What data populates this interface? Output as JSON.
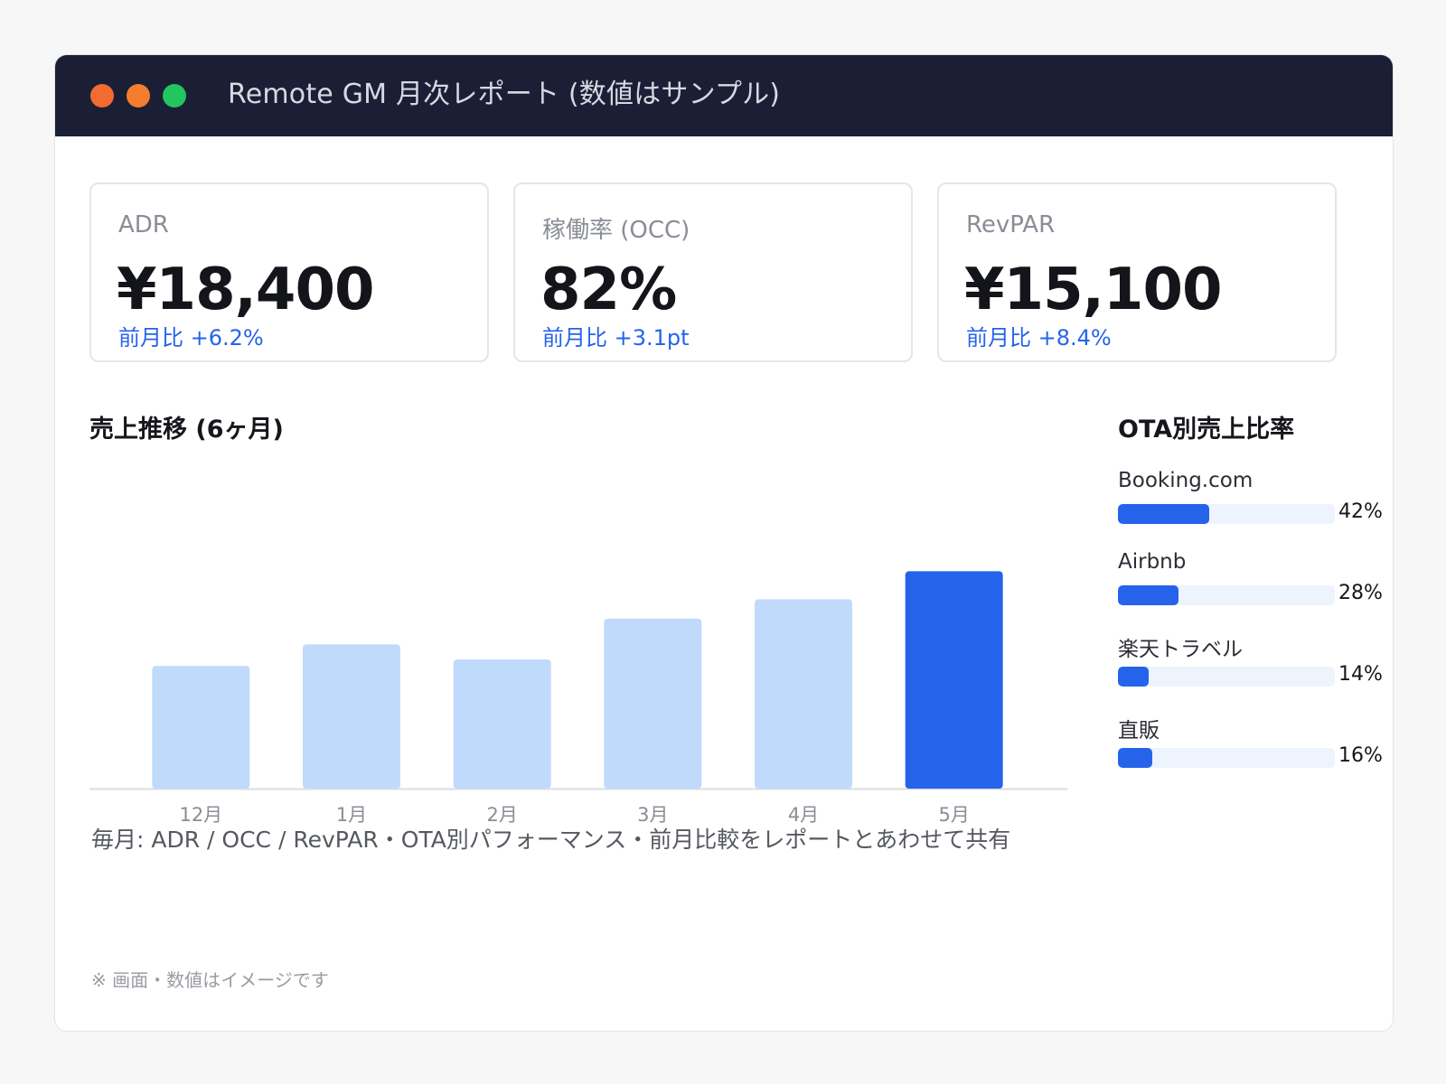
{
  "window": {
    "title": "Remote GM 月次レポート (数値はサンプル)",
    "dot_colors": [
      "#f26b2f",
      "#f47e2e",
      "#22c55e"
    ]
  },
  "kpis": [
    {
      "label": "ADR",
      "value": "¥18,400",
      "delta": "前月比 +6.2%"
    },
    {
      "label": "稼働率 (OCC)",
      "value": "82%",
      "delta": "前月比 +3.1pt"
    },
    {
      "label": "RevPAR",
      "value": "¥15,100",
      "delta": "前月比 +8.4%"
    }
  ],
  "sales": {
    "title": "売上推移 (6ヶ月)"
  },
  "chart_data": {
    "type": "bar",
    "categories": [
      "12月",
      "1月",
      "2月",
      "3月",
      "4月",
      "5月"
    ],
    "values": [
      57,
      67,
      60,
      79,
      88,
      101
    ],
    "ylim": [
      0,
      110
    ],
    "highlight_index": 5,
    "colors": {
      "normal": "#c0dafc",
      "highlight": "#2563eb",
      "axis": "#dcdde2",
      "tick": "#8a8d96"
    }
  },
  "ota": {
    "title": "OTA別売上比率",
    "items": [
      {
        "label": "Booking.com",
        "pct_label": "42%",
        "fill": 0.42
      },
      {
        "label": "Airbnb",
        "pct_label": "28%",
        "fill": 0.28
      },
      {
        "label": "楽天トラベル",
        "pct_label": "14%",
        "fill": 0.14
      },
      {
        "label": "直販",
        "pct_label": "16%",
        "fill": 0.16
      }
    ]
  },
  "caption": "毎月: ADR / OCC / RevPAR・OTA別パフォーマンス・前月比較をレポートとあわせて共有",
  "footnote": "※ 画面・数値はイメージです"
}
